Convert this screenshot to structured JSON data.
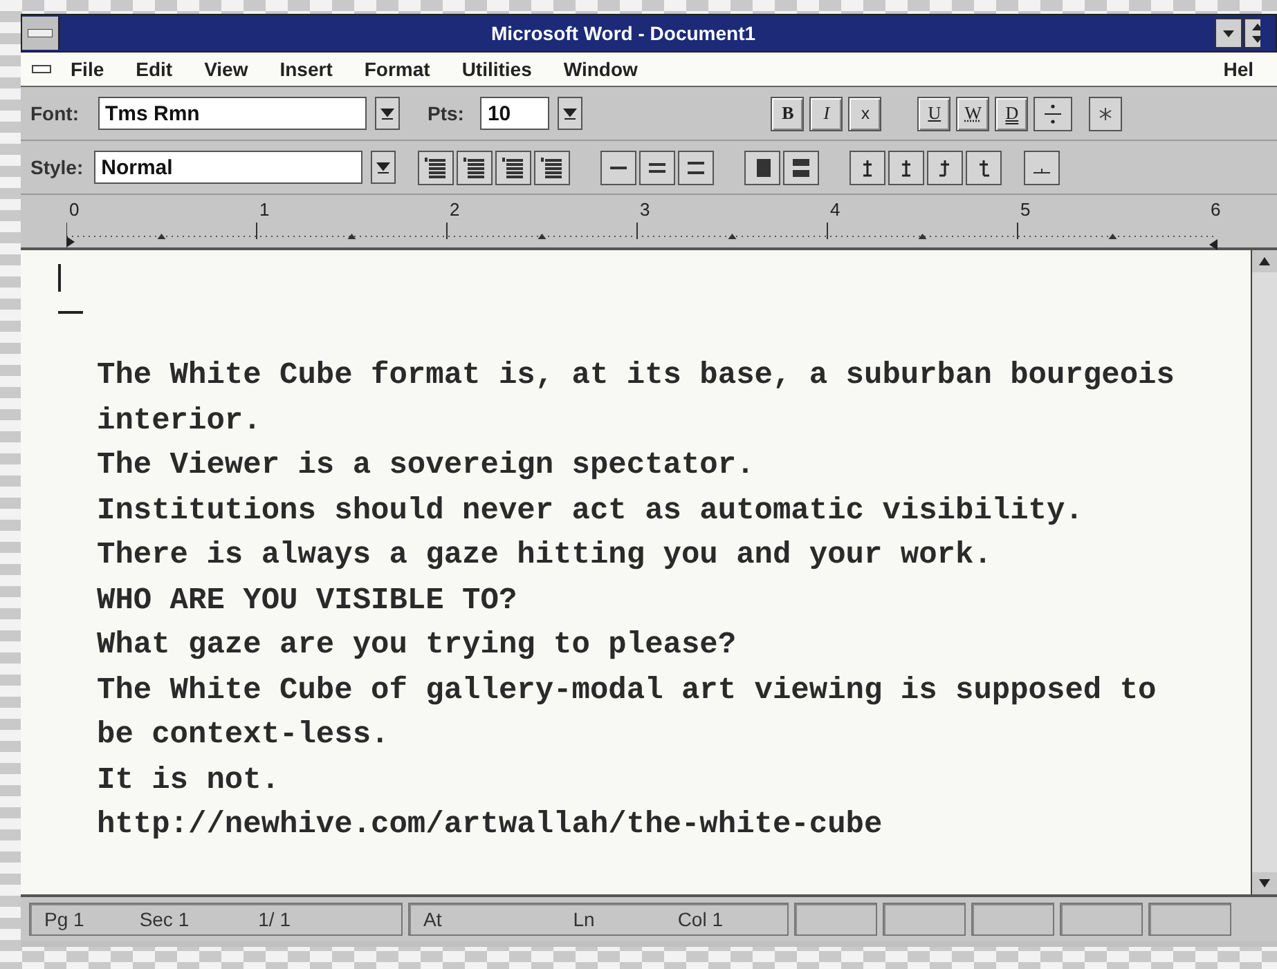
{
  "window": {
    "title": "Microsoft Word - Document1"
  },
  "menu": [
    "File",
    "Edit",
    "View",
    "Insert",
    "Format",
    "Utilities",
    "Window"
  ],
  "help_menu": "Hel",
  "font_bar": {
    "font_label": "Font:",
    "font": "Tms Rmn",
    "size_label": "Pts:",
    "size": "10",
    "format_buttons": [
      {
        "label": "B",
        "kind": "bold"
      },
      {
        "label": "I",
        "kind": "italic"
      },
      {
        "label": "x",
        "kind": "plain"
      },
      {
        "label": "U",
        "kind": "underline"
      },
      {
        "label": "W",
        "kind": "word-underline"
      },
      {
        "label": "D",
        "kind": "double-underline"
      }
    ]
  },
  "style_bar": {
    "label": "Style:",
    "style": "Normal"
  },
  "ruler": {
    "marks": [
      "0",
      "1",
      "2",
      "3",
      "4",
      "5",
      "6"
    ]
  },
  "document": {
    "paragraphs": [
      "The White Cube format is, at its base, a suburban bourgeois interior.",
      "The Viewer is a sovereign spectator.",
      "Institutions should never act as automatic visibility.",
      "There is always a gaze hitting you and your work.",
      "WHO ARE YOU VISIBLE TO?",
      "What gaze are you trying to please?",
      "The White Cube of gallery-modal art viewing is supposed to be context-less.",
      "It is not.",
      "http://newhive.com/artwallah/the-white-cube"
    ]
  },
  "status_bar": {
    "position": [
      "Pg 1",
      "Sec 1",
      "1/ 1"
    ],
    "location": [
      "At",
      "Ln",
      "Col 1"
    ]
  }
}
